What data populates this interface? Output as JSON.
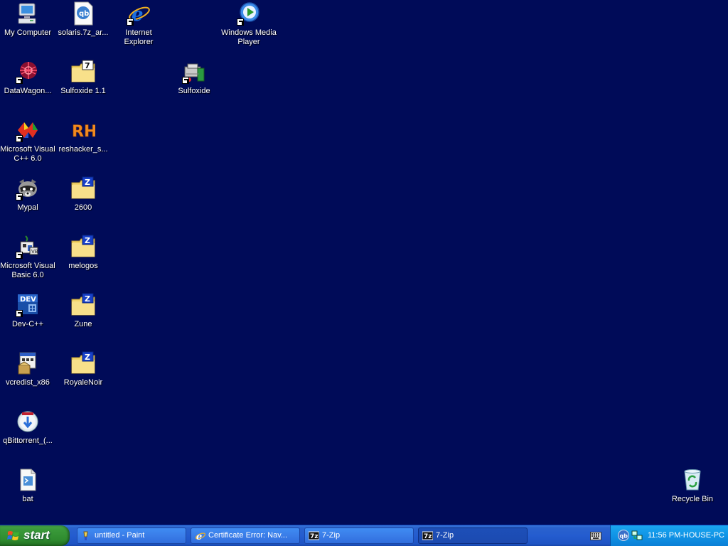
{
  "desktop": {
    "icons": {
      "my_computer": "My Computer",
      "solaris": "solaris.7z_ar...",
      "internet_explorer": "Internet Explorer",
      "windows_media_player": "Windows Media Player",
      "datawagon": "DataWagon...",
      "sulfoxide_1_1": "Sulfoxide 1.1",
      "sulfoxide": "Sulfoxide",
      "visual_cpp": "Microsoft Visual C++ 6.0",
      "reshacker": "reshacker_s...",
      "mypal": "Mypal",
      "folder_2600": "2600",
      "visual_basic": "Microsoft Visual Basic 6.0",
      "melogos": "melogos",
      "dev_cpp": "Dev-C++",
      "zune": "Zune",
      "vcredist": "vcredist_x86",
      "royalenoir": "RoyaleNoir",
      "qbittorrent": "qBittorrent_(...",
      "bat": "bat",
      "recycle_bin": "Recycle Bin"
    }
  },
  "taskbar": {
    "start_label": "start",
    "tasks": [
      {
        "label": "untitled - Paint",
        "icon": "paint-icon"
      },
      {
        "label": "Certificate Error: Nav...",
        "icon": "ie-icon"
      },
      {
        "label": "7-Zip",
        "icon": "7zip-icon"
      },
      {
        "label": "7-Zip",
        "icon": "7zip-icon"
      }
    ],
    "active_task": 3,
    "clock": "11:56 PM-HOUSE-PC"
  },
  "colors": {
    "desktop_background": "#000b58",
    "taskbar_blue": "#245ccf",
    "start_green": "#3a9a3a",
    "tray_blue": "#1094e6",
    "folder_yellow": "#f2d46b",
    "zip_badge_blue": "#1740c8"
  }
}
